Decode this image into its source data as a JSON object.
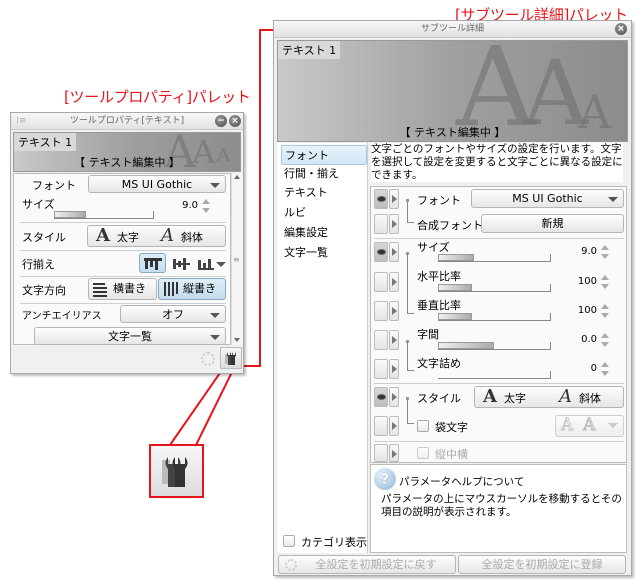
{
  "annotations": {
    "tool_property_palette": "[ツールプロパティ]パレット",
    "sub_tool_detail_palette": "[サブツール詳細]パレット"
  },
  "colors": {
    "annotation_red": "#e8141c",
    "selected_blue": "#c3dcee"
  },
  "tool_property": {
    "title": "ツールプロパティ[テキスト]",
    "preview_name": "テキスト 1",
    "preview_status": "【 テキスト編集中 】",
    "font_label": "フォント",
    "font_value": "MS UI Gothic",
    "size_label": "サイズ",
    "size_value": "9.0",
    "size_fraction": 0.32,
    "style_label": "スタイル",
    "bold_label": "太字",
    "italic_label": "斜体",
    "align_label": "行揃え",
    "direction_label": "文字方向",
    "horizontal_label": "横書き",
    "vertical_label": "縦書き",
    "antialias_label": "アンチエイリアス",
    "antialias_value": "オフ",
    "char_list_label": "文字一覧",
    "wrench_icon": "wrench-icon"
  },
  "sub_tool_detail": {
    "title": "サブツール詳細",
    "preview_name": "テキスト 1",
    "preview_status": "【 テキスト編集中 】",
    "categories": [
      {
        "label": "フォント",
        "selected": true
      },
      {
        "label": "行間・揃え",
        "selected": false
      },
      {
        "label": "テキスト",
        "selected": false
      },
      {
        "label": "ルビ",
        "selected": false
      },
      {
        "label": "編集設定",
        "selected": false
      },
      {
        "label": "文字一覧",
        "selected": false
      }
    ],
    "description": "文字ごとのフォントやサイズの設定を行います。文字を選択して設定を変更すると文字ごとに異なる設定にできます。",
    "params": {
      "font_label": "フォント",
      "font_value": "MS UI Gothic",
      "composite_font_label": "合成フォント",
      "composite_font_button": "新規",
      "size_label": "サイズ",
      "size_value": "9.0",
      "size_fraction": 0.32,
      "hscale_label": "水平比率",
      "hscale_value": "100",
      "hscale_fraction": 0.3,
      "vscale_label": "垂直比率",
      "vscale_value": "100",
      "vscale_fraction": 0.3,
      "spacing_label": "字間",
      "spacing_value": "0.0",
      "spacing_fraction": 0.5,
      "kerning_label": "文字詰め",
      "kerning_value": "0",
      "kerning_fraction": 0,
      "style_label": "スタイル",
      "bold_label": "太字",
      "italic_label": "斜体",
      "outline_label": "袋文字",
      "tcy_label": "縦中横"
    },
    "help_title": "パラメータヘルプについて",
    "help_text": "パラメータの上にマウスカーソルを移動するとその項目の説明が表示されます。",
    "category_display_label": "カテゴリ表示",
    "reset_all_label": "全設定を初期設定に戻す",
    "register_all_label": "全設定を初期設定に登録"
  }
}
